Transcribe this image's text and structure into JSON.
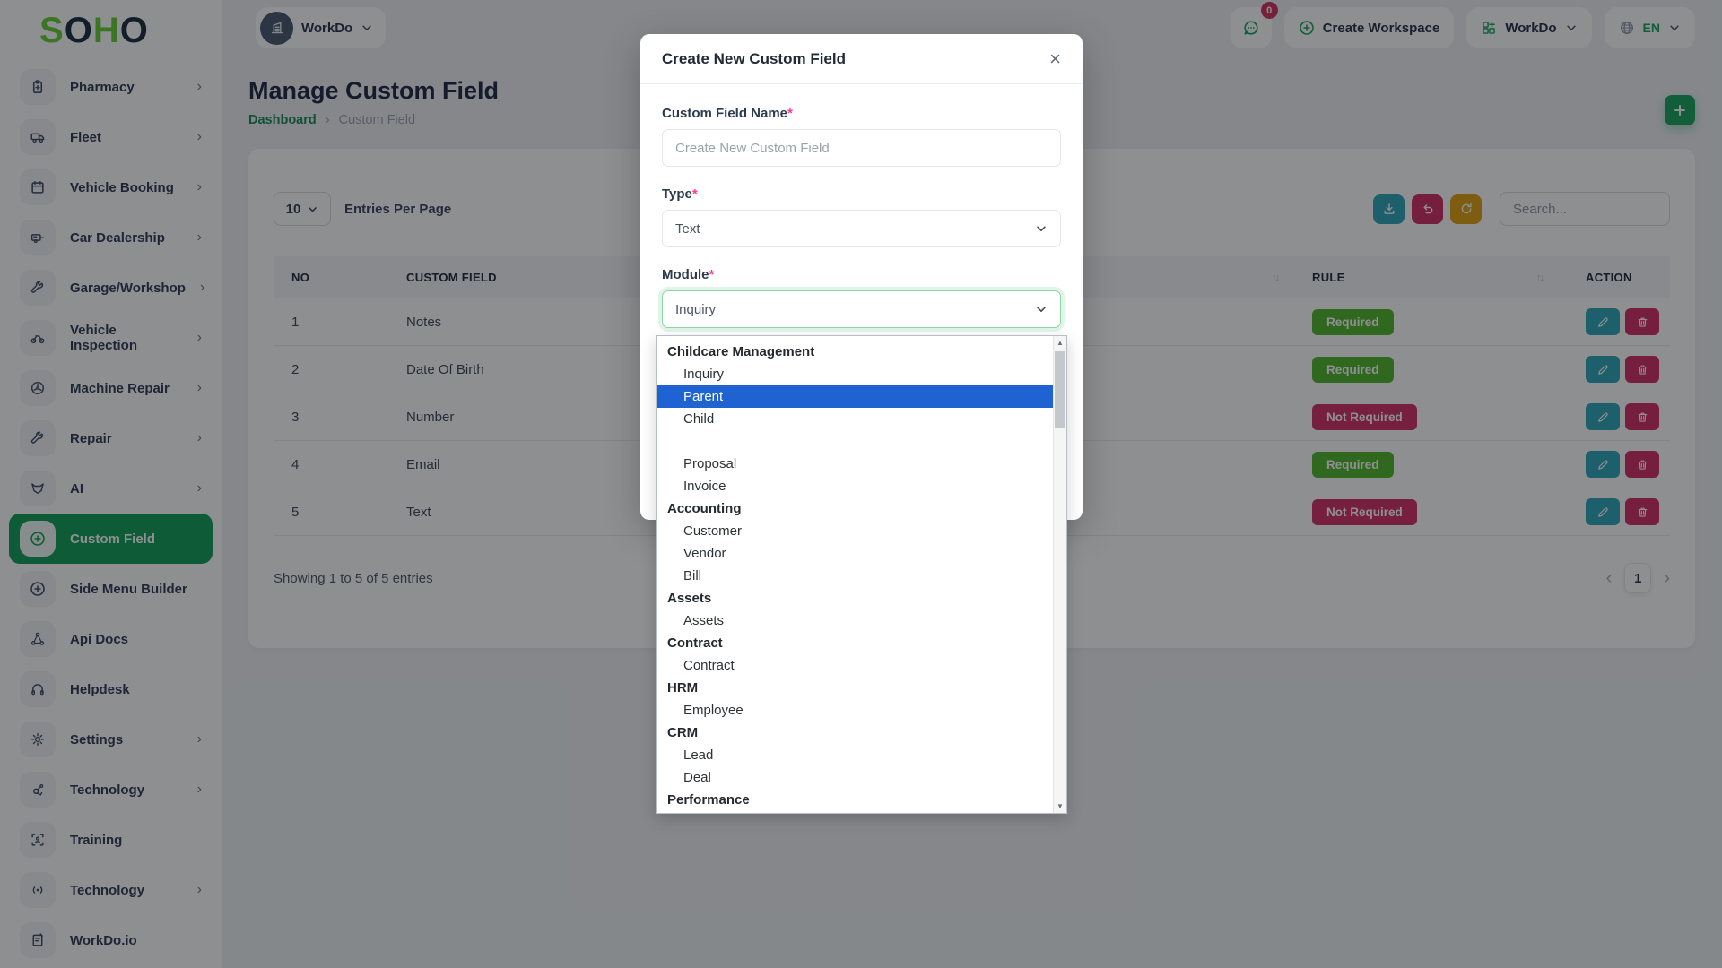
{
  "brand": {
    "logo_s": "S",
    "logo_o1": "O",
    "logo_h": "H",
    "logo_o2": "O",
    "accent_green": "#17a35b",
    "logo_green": "#62cc2e",
    "logo_navy": "#152a3e"
  },
  "sidebar": {
    "items": [
      {
        "label": "Pharmacy",
        "icon": "clipboard-icon"
      },
      {
        "label": "Fleet",
        "icon": "truck-icon"
      },
      {
        "label": "Vehicle Booking",
        "icon": "calendar-icon"
      },
      {
        "label": "Car Dealership",
        "icon": "car-icon"
      },
      {
        "label": "Garage/Workshop",
        "icon": "wrench-icon"
      },
      {
        "label": "Vehicle Inspection",
        "icon": "bike-icon"
      },
      {
        "label": "Machine Repair",
        "icon": "fan-icon"
      },
      {
        "label": "Repair",
        "icon": "wrench-icon"
      },
      {
        "label": "AI",
        "icon": "fox-icon"
      },
      {
        "label": "Custom Field",
        "icon": "plus-circle-icon",
        "active": true
      },
      {
        "label": "Side Menu Builder",
        "icon": "plus-circle-icon"
      },
      {
        "label": "Api Docs",
        "icon": "nodes-icon"
      },
      {
        "label": "Helpdesk",
        "icon": "headset-icon"
      },
      {
        "label": "Settings",
        "icon": "gear-icon"
      },
      {
        "label": "Technology",
        "icon": "hub-icon"
      },
      {
        "label": "Training",
        "icon": "scan-icon"
      },
      {
        "label": "Technology",
        "icon": "radio-icon"
      },
      {
        "label": "WorkDo.io",
        "icon": "doc-icon"
      }
    ],
    "chevron_glyph": "›"
  },
  "header": {
    "workspace": "WorkDo",
    "chat_badge": "0",
    "create_workspace": "Create Workspace",
    "workdo_menu": "WorkDo",
    "language": "EN"
  },
  "page": {
    "title": "Manage Custom Field",
    "breadcrumb": {
      "home": "Dashboard",
      "separator": "›",
      "current": "Custom Field"
    }
  },
  "toolbar": {
    "entries_value": "10",
    "entries_label": "Entries Per Page",
    "search_placeholder": "Search..."
  },
  "table": {
    "columns": {
      "no": "NO",
      "custom_field": "CUSTOM FIELD",
      "rule": "RULE",
      "action": "ACTION"
    },
    "sort_glyph": "↑↓",
    "rows": [
      {
        "no": "1",
        "field": "Notes",
        "rule": "Required"
      },
      {
        "no": "2",
        "field": "Date Of Birth",
        "rule": "Required"
      },
      {
        "no": "3",
        "field": "Number",
        "rule": "Not Required"
      },
      {
        "no": "4",
        "field": "Email",
        "rule": "Required"
      },
      {
        "no": "5",
        "field": "Text",
        "rule": "Not Required"
      }
    ]
  },
  "footer": {
    "summary": "Showing 1 to 5 of 5 entries",
    "prev": "‹",
    "page": "1",
    "next": "›"
  },
  "modal": {
    "title": "Create New Custom Field",
    "close_glyph": "×",
    "name_label": "Custom Field Name",
    "required_mark": "*",
    "name_placeholder": "Create New Custom Field",
    "type_label": "Type",
    "type_value": "Text",
    "module_label": "Module",
    "module_value": "Inquiry"
  },
  "module_dropdown": {
    "selected": "Parent",
    "entries": [
      {
        "type": "group",
        "label": "Childcare Management"
      },
      {
        "type": "item",
        "label": "Inquiry"
      },
      {
        "type": "item",
        "label": "Parent"
      },
      {
        "type": "item",
        "label": "Child"
      },
      {
        "type": "group",
        "label": ""
      },
      {
        "type": "item",
        "label": "Proposal"
      },
      {
        "type": "item",
        "label": "Invoice"
      },
      {
        "type": "group",
        "label": "Accounting"
      },
      {
        "type": "item",
        "label": "Customer"
      },
      {
        "type": "item",
        "label": "Vendor"
      },
      {
        "type": "item",
        "label": "Bill"
      },
      {
        "type": "group",
        "label": "Assets"
      },
      {
        "type": "item",
        "label": "Assets"
      },
      {
        "type": "group",
        "label": "Contract"
      },
      {
        "type": "item",
        "label": "Contract"
      },
      {
        "type": "group",
        "label": "HRM"
      },
      {
        "type": "item",
        "label": "Employee"
      },
      {
        "type": "group",
        "label": "CRM"
      },
      {
        "type": "item",
        "label": "Lead"
      },
      {
        "type": "item",
        "label": "Deal"
      },
      {
        "type": "group",
        "label": "Performance"
      }
    ]
  }
}
